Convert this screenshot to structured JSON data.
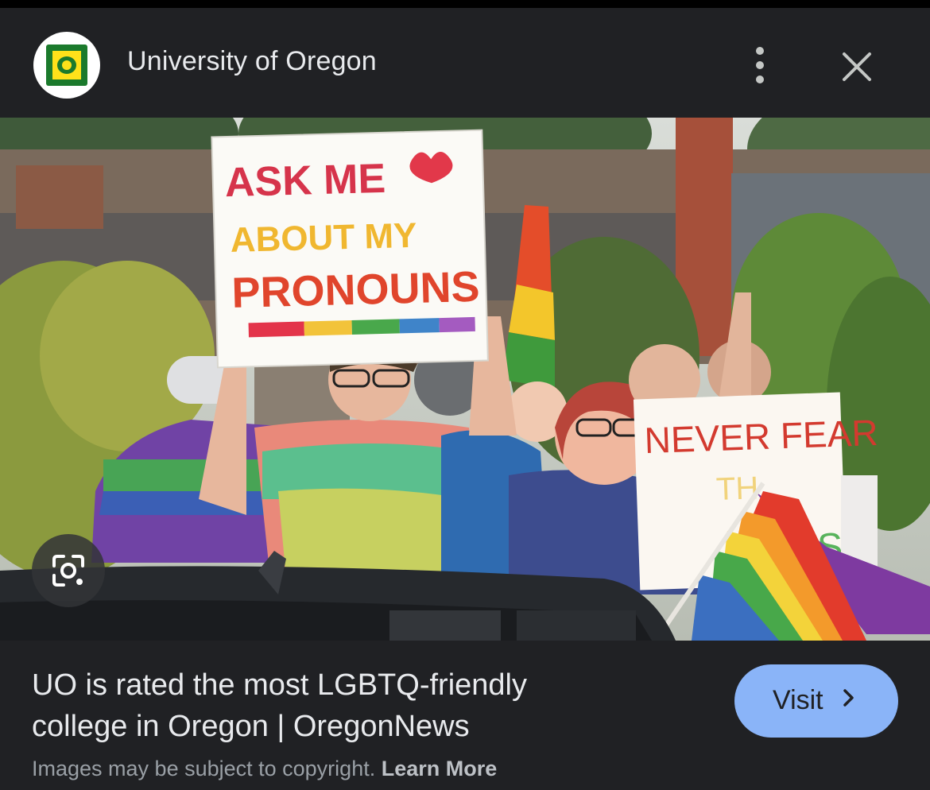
{
  "header": {
    "logo_letter": "O",
    "site_name": "University of Oregon",
    "menu_icon": "more-vertical-icon",
    "close_icon": "close-icon"
  },
  "image": {
    "sign_main": [
      "ASK ME",
      "ABOUT MY",
      "PRONOUNS"
    ],
    "sign_right": "NEVER FEAR",
    "lens_icon": "google-lens-icon"
  },
  "result": {
    "title_line1": "UO is rated the most LGBTQ-friendly",
    "title_line2": "college in Oregon | OregonNews",
    "visit_label": "Visit",
    "copyright_text": "Images may be subject to copyright.",
    "learn_more": "Learn More"
  },
  "colors": {
    "background": "#202124",
    "visit_button": "#8ab4f8",
    "oregon_green": "#1b7a2c",
    "oregon_yellow": "#fee11a"
  }
}
